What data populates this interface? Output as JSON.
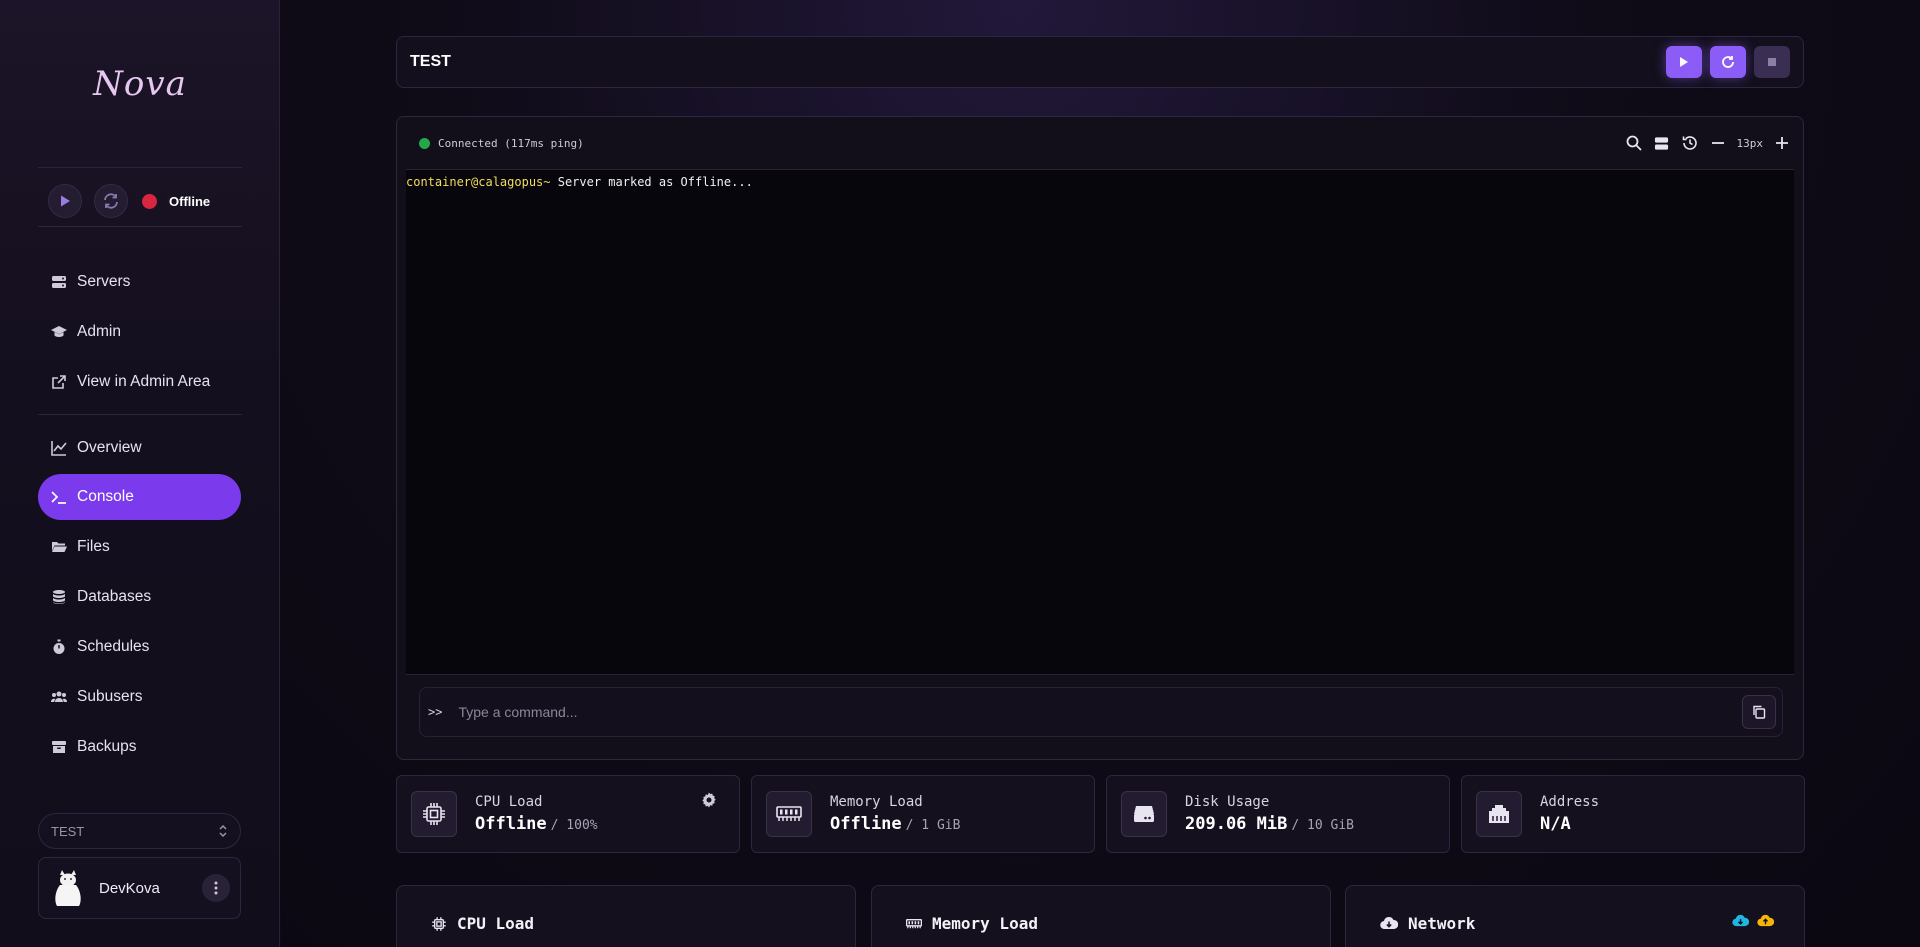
{
  "app": {
    "logo": "Nova"
  },
  "server_status": {
    "label": "Offline"
  },
  "nav": {
    "servers": "Servers",
    "admin": "Admin",
    "view_admin": "View in Admin Area",
    "overview": "Overview",
    "console": "Console",
    "files": "Files",
    "databases": "Databases",
    "schedules": "Schedules",
    "subusers": "Subusers",
    "backups": "Backups"
  },
  "server_select": {
    "value": "TEST"
  },
  "user": {
    "name": "DevKova"
  },
  "header": {
    "server_name": "TEST"
  },
  "console": {
    "connection": "Connected (117ms ping)",
    "font_size": "13px",
    "lines": [
      {
        "prompt": "container@calagopus~",
        "message": " Server marked as Offline..."
      }
    ],
    "prefix": ">>",
    "placeholder": "Type a command..."
  },
  "stats": {
    "cpu": {
      "title": "CPU Load",
      "value": "Offline",
      "sub": "/ 100%"
    },
    "memory": {
      "title": "Memory Load",
      "value": "Offline",
      "sub": "/ 1 GiB"
    },
    "disk": {
      "title": "Disk Usage",
      "value": "209.06 MiB",
      "sub": "/ 10 GiB"
    },
    "address": {
      "title": "Address",
      "value": "N/A"
    }
  },
  "charts": {
    "cpu": "CPU Load",
    "memory": "Memory Load",
    "network": "Network"
  },
  "colors": {
    "accent": "#7c3aed",
    "offline": "#d7263d",
    "connected": "#22a84a",
    "prompt": "#f3dd5d"
  }
}
